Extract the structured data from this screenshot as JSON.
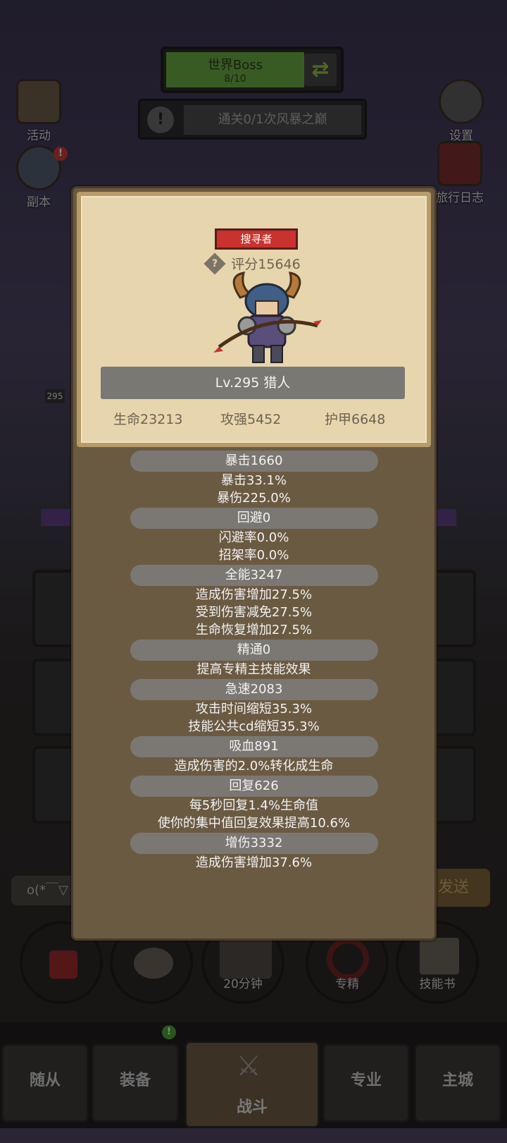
{
  "hud": {
    "world_boss_title": "世界Boss",
    "world_boss_progress": "8/10",
    "quest_text": "通关0/1次风暴之巅",
    "left_buttons": [
      {
        "label": "活动",
        "icon": "scroll-icon"
      },
      {
        "label": "副本",
        "icon": "portal-icon"
      }
    ],
    "right_buttons": [
      {
        "label": "设置",
        "icon": "gear-icon"
      },
      {
        "label": "旅行日志",
        "icon": "book-icon"
      }
    ],
    "hero_level_badge": "295",
    "chat_placeholder": "o(*￣▽",
    "send_label": "发送",
    "bottom_skills": [
      {
        "label": "",
        "icon": "potion-icon"
      },
      {
        "label": "",
        "icon": "bread-icon"
      },
      {
        "label": "20分钟",
        "icon": "chest-icon"
      },
      {
        "label": "专精",
        "icon": "target-icon"
      },
      {
        "label": "技能书",
        "icon": "skillbook-icon"
      }
    ],
    "nav": [
      {
        "label": "随从"
      },
      {
        "label": "装备",
        "badge": "!"
      },
      {
        "label": "战斗"
      },
      {
        "label": "专业"
      },
      {
        "label": "主城"
      }
    ]
  },
  "hero": {
    "class_tag": "搜寻者",
    "score_label": "评分15646",
    "level_label": "Lv.295 猎人",
    "base_stats": {
      "hp": "生命23213",
      "attack": "攻强5452",
      "armor": "护甲6648"
    }
  },
  "stat_groups": [
    {
      "title": "暴击1660",
      "lines": [
        "暴击33.1%",
        "暴伤225.0%"
      ]
    },
    {
      "title": "回避0",
      "lines": [
        "闪避率0.0%",
        "招架率0.0%"
      ]
    },
    {
      "title": "全能3247",
      "lines": [
        "造成伤害增加27.5%",
        "受到伤害减免27.5%",
        "生命恢复增加27.5%"
      ]
    },
    {
      "title": "精通0",
      "lines": [
        "提高专精主技能效果"
      ]
    },
    {
      "title": "急速2083",
      "lines": [
        "攻击时间缩短35.3%",
        "技能公共cd缩短35.3%"
      ]
    },
    {
      "title": "吸血891",
      "lines": [
        "造成伤害的2.0%转化成生命"
      ]
    },
    {
      "title": "回复626",
      "lines": [
        "每5秒回复1.4%生命值",
        "使你的集中值回复效果提高10.6%"
      ]
    },
    {
      "title": "增伤3332",
      "lines": [
        "造成伤害增加37.6%"
      ]
    }
  ]
}
